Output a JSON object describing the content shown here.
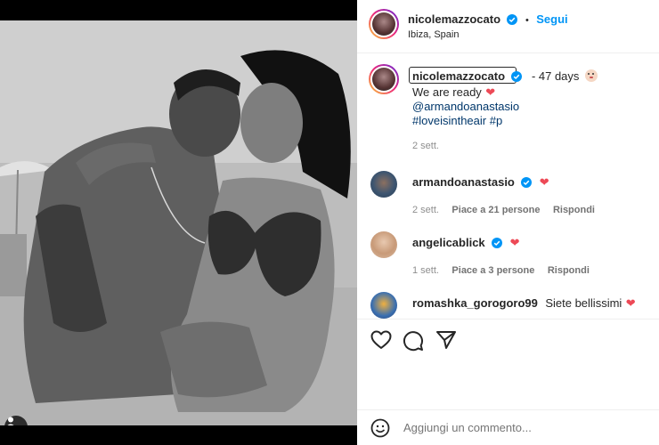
{
  "post": {
    "author": "nicolemazzocato",
    "follow_label": "Segui",
    "location": "Ibiza, Spain",
    "caption_author": "nicolemazzocato",
    "caption_suffix": "- 47 days",
    "caption_line2": "We are ready",
    "mention": "@armandoanastasio",
    "hashtags": "#loveisintheair #p",
    "caption_time": "2 sett."
  },
  "comments": [
    {
      "user": "armandoanastasio",
      "text": "",
      "time": "2 sett.",
      "likes": "Piace a 21 persone",
      "reply": "Rispondi"
    },
    {
      "user": "angelicablick",
      "text": "",
      "time": "1 sett.",
      "likes": "Piace a 3 persone",
      "reply": "Rispondi"
    },
    {
      "user": "romashka_gorogoro99",
      "text": "Siete bellissimi"
    }
  ],
  "add_comment": {
    "placeholder": "Aggiungi un commento..."
  },
  "icons": {
    "verified": "verified-badge-icon",
    "like": "heart-icon",
    "comment": "comment-bubble-icon",
    "share": "paper-plane-icon",
    "emoji": "smiley-icon",
    "tag": "user-tag-icon",
    "baby": "baby-emoji-icon"
  },
  "colors": {
    "accent": "#0095f6",
    "heart": "#ed4956",
    "verified": "#0095f6"
  }
}
